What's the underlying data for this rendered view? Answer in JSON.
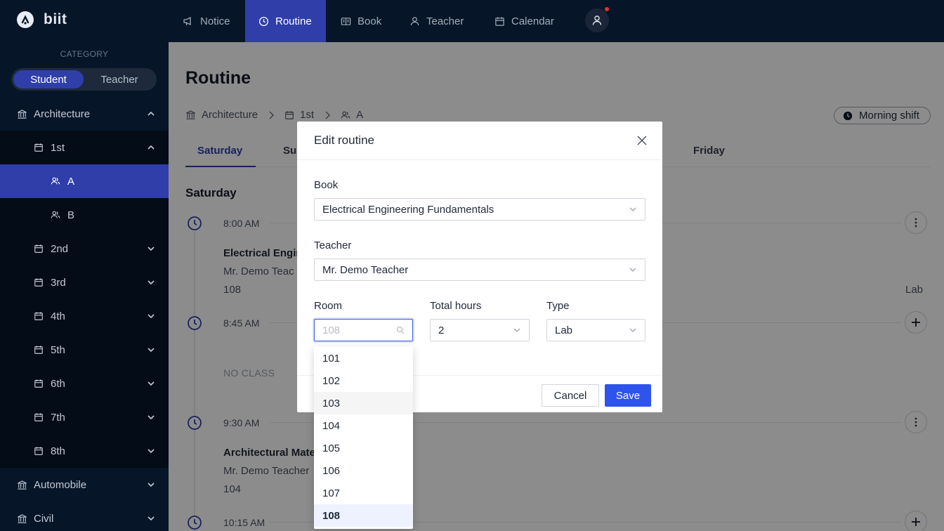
{
  "app": {
    "name": "biit"
  },
  "nav": {
    "items": [
      {
        "label": "Notice",
        "icon": "megaphone-icon"
      },
      {
        "label": "Routine",
        "icon": "clock-icon",
        "active": true
      },
      {
        "label": "Book",
        "icon": "book-icon"
      },
      {
        "label": "Teacher",
        "icon": "user-icon"
      },
      {
        "label": "Calendar",
        "icon": "calendar-icon"
      }
    ],
    "avatar_icon": "user-avatar-icon"
  },
  "sidebar": {
    "category_label": "CATEGORY",
    "segments": [
      "Student",
      "Teacher"
    ],
    "departments": [
      "Architecture",
      "Automobile",
      "Civil"
    ],
    "semesters": [
      "1st",
      "2nd",
      "3rd",
      "4th",
      "5th",
      "6th",
      "7th",
      "8th"
    ],
    "sections": [
      "A",
      "B"
    ]
  },
  "main": {
    "title": "Routine",
    "breadcrumb": [
      "Architecture",
      "1st",
      "A"
    ],
    "shift": "Morning shift",
    "tabs": [
      "Saturday",
      "Sun",
      "Friday"
    ],
    "day_title": "Saturday",
    "slots": [
      {
        "time": "8:00 AM",
        "title": "Electrical Engin",
        "teacher": "Mr. Demo Teac",
        "room": "108",
        "type": "Lab"
      },
      {
        "time": "8:45 AM",
        "empty": "NO CLASS"
      },
      {
        "time": "9:30 AM",
        "title": "Architectural Mate",
        "teacher": "Mr. Demo Teacher",
        "room": "104"
      },
      {
        "time": "10:15 AM"
      }
    ]
  },
  "modal": {
    "title": "Edit routine",
    "book_label": "Book",
    "book_value": "Electrical Engineering Fundamentals",
    "teacher_label": "Teacher",
    "teacher_value": "Mr. Demo Teacher",
    "room_label": "Room",
    "room_placeholder": "108",
    "hours_label": "Total hours",
    "hours_value": "2",
    "type_label": "Type",
    "type_value": "Lab",
    "cancel_label": "Cancel",
    "save_label": "Save"
  },
  "room_options": [
    "101",
    "102",
    "103",
    "104",
    "105",
    "106",
    "107",
    "108"
  ],
  "colors": {
    "nav_bg": "#061528",
    "accent": "#2f3ea8",
    "primary_button": "#2f54eb"
  }
}
